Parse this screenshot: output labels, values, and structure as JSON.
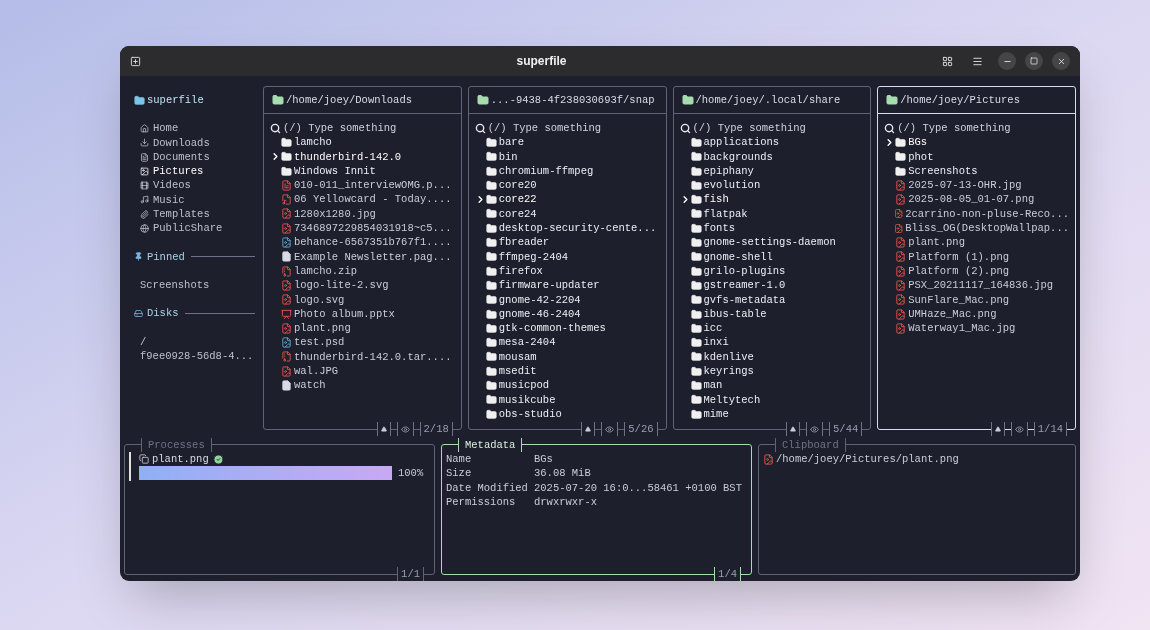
{
  "window": {
    "title": "superfile"
  },
  "sidebar": {
    "title": "superfile",
    "items": [
      {
        "label": "Home",
        "kind": "home",
        "selected": false
      },
      {
        "label": "Downloads",
        "kind": "downloads",
        "selected": false
      },
      {
        "label": "Documents",
        "kind": "documents",
        "selected": false
      },
      {
        "label": "Pictures",
        "kind": "pictures",
        "selected": true
      },
      {
        "label": "Videos",
        "kind": "videos",
        "selected": false
      },
      {
        "label": "Music",
        "kind": "music",
        "selected": false
      },
      {
        "label": "Templates",
        "kind": "templates",
        "selected": false
      },
      {
        "label": "PublicShare",
        "kind": "public",
        "selected": false
      }
    ],
    "pinned": {
      "title": "Pinned",
      "items": [
        "Screenshots"
      ]
    },
    "disks": {
      "title": "Disks",
      "items": [
        "/",
        "f9ee0928-56d8-4..."
      ]
    }
  },
  "panels": [
    {
      "path": "/home/joey/Downloads",
      "focused": false,
      "search": {
        "placeholder": "(/) Type something"
      },
      "count": "2/18",
      "entries": [
        {
          "name": "lamcho",
          "kind": "folder",
          "selected": false
        },
        {
          "name": "thunderbird-142.0",
          "kind": "folder",
          "selected": true
        },
        {
          "name": "Windows Innit",
          "kind": "folder",
          "selected": false
        },
        {
          "name": "010-011_interviewOMG.p...",
          "kind": "pdf",
          "selected": false
        },
        {
          "name": "06 Yellowcard - Today....",
          "kind": "audio",
          "selected": false
        },
        {
          "name": "1280x1280.jpg",
          "kind": "image",
          "selected": false
        },
        {
          "name": "7346897229854031918~c5...",
          "kind": "image",
          "selected": false
        },
        {
          "name": "behance-6567351b767f1....",
          "kind": "psd",
          "selected": false
        },
        {
          "name": "Example Newsletter.pag...",
          "kind": "document",
          "selected": false
        },
        {
          "name": "lamcho.zip",
          "kind": "archive",
          "selected": false
        },
        {
          "name": "logo-lite-2.svg",
          "kind": "image",
          "selected": false
        },
        {
          "name": "logo.svg",
          "kind": "image",
          "selected": false
        },
        {
          "name": "Photo album.pptx",
          "kind": "slides",
          "selected": false
        },
        {
          "name": "plant.png",
          "kind": "image",
          "selected": false
        },
        {
          "name": "test.psd",
          "kind": "psd",
          "selected": false
        },
        {
          "name": "thunderbird-142.0.tar....",
          "kind": "archive",
          "selected": false
        },
        {
          "name": "wal.JPG",
          "kind": "image",
          "selected": false
        },
        {
          "name": "watch",
          "kind": "document",
          "selected": false
        }
      ]
    },
    {
      "path": "...-9438-4f238030693f/snap",
      "focused": false,
      "search": {
        "placeholder": "(/) Type something"
      },
      "count": "5/26",
      "entries": [
        {
          "name": "bare",
          "kind": "folder",
          "selected": false
        },
        {
          "name": "bin",
          "kind": "folder",
          "selected": false
        },
        {
          "name": "chromium-ffmpeg",
          "kind": "folder",
          "selected": false
        },
        {
          "name": "core20",
          "kind": "folder",
          "selected": false
        },
        {
          "name": "core22",
          "kind": "folder",
          "selected": true
        },
        {
          "name": "core24",
          "kind": "folder",
          "selected": false
        },
        {
          "name": "desktop-security-cente...",
          "kind": "folder",
          "selected": false
        },
        {
          "name": "fbreader",
          "kind": "folder",
          "selected": false
        },
        {
          "name": "ffmpeg-2404",
          "kind": "folder",
          "selected": false
        },
        {
          "name": "firefox",
          "kind": "folder",
          "selected": false
        },
        {
          "name": "firmware-updater",
          "kind": "folder",
          "selected": false
        },
        {
          "name": "gnome-42-2204",
          "kind": "folder",
          "selected": false
        },
        {
          "name": "gnome-46-2404",
          "kind": "folder",
          "selected": false
        },
        {
          "name": "gtk-common-themes",
          "kind": "folder",
          "selected": false
        },
        {
          "name": "mesa-2404",
          "kind": "folder",
          "selected": false
        },
        {
          "name": "mousam",
          "kind": "folder",
          "selected": false
        },
        {
          "name": "msedit",
          "kind": "folder",
          "selected": false
        },
        {
          "name": "musicpod",
          "kind": "folder",
          "selected": false
        },
        {
          "name": "musikcube",
          "kind": "folder",
          "selected": false
        },
        {
          "name": "obs-studio",
          "kind": "folder",
          "selected": false
        }
      ]
    },
    {
      "path": "/home/joey/.local/share",
      "focused": false,
      "search": {
        "placeholder": "(/) Type something"
      },
      "count": "5/44",
      "entries": [
        {
          "name": "applications",
          "kind": "folder",
          "selected": false
        },
        {
          "name": "backgrounds",
          "kind": "folder",
          "selected": false
        },
        {
          "name": "epiphany",
          "kind": "folder",
          "selected": false
        },
        {
          "name": "evolution",
          "kind": "folder",
          "selected": false
        },
        {
          "name": "fish",
          "kind": "folder",
          "selected": true
        },
        {
          "name": "flatpak",
          "kind": "folder",
          "selected": false
        },
        {
          "name": "fonts",
          "kind": "folder",
          "selected": false
        },
        {
          "name": "gnome-settings-daemon",
          "kind": "folder",
          "selected": false
        },
        {
          "name": "gnome-shell",
          "kind": "folder",
          "selected": false
        },
        {
          "name": "grilo-plugins",
          "kind": "folder",
          "selected": false
        },
        {
          "name": "gstreamer-1.0",
          "kind": "folder",
          "selected": false
        },
        {
          "name": "gvfs-metadata",
          "kind": "folder",
          "selected": false
        },
        {
          "name": "ibus-table",
          "kind": "folder",
          "selected": false
        },
        {
          "name": "icc",
          "kind": "folder",
          "selected": false
        },
        {
          "name": "inxi",
          "kind": "folder",
          "selected": false
        },
        {
          "name": "kdenlive",
          "kind": "folder",
          "selected": false
        },
        {
          "name": "keyrings",
          "kind": "folder",
          "selected": false
        },
        {
          "name": "man",
          "kind": "folder",
          "selected": false
        },
        {
          "name": "Meltytech",
          "kind": "folder",
          "selected": false
        },
        {
          "name": "mime",
          "kind": "folder",
          "selected": false
        }
      ]
    },
    {
      "path": "/home/joey/Pictures",
      "focused": true,
      "search": {
        "placeholder": "(/) Type something"
      },
      "count": "1/14",
      "entries": [
        {
          "name": "BGs",
          "kind": "folder",
          "selected": true
        },
        {
          "name": "phot",
          "kind": "folder",
          "selected": false
        },
        {
          "name": "Screenshots",
          "kind": "folder",
          "selected": false
        },
        {
          "name": "2025-07-13-OHR.jpg",
          "kind": "image",
          "selected": false
        },
        {
          "name": "2025-08-05_01-07.png",
          "kind": "image",
          "selected": false
        },
        {
          "name": "2carrino-non-pluse-Reco...",
          "kind": "image",
          "selected": false
        },
        {
          "name": "Bliss_OG(DesktopWallpap...",
          "kind": "image",
          "selected": false
        },
        {
          "name": "plant.png",
          "kind": "image",
          "selected": false
        },
        {
          "name": "Platform (1).png",
          "kind": "image",
          "selected": false
        },
        {
          "name": "Platform (2).png",
          "kind": "image",
          "selected": false
        },
        {
          "name": "PSX_20211117_164836.jpg",
          "kind": "image",
          "selected": false
        },
        {
          "name": "SunFlare_Mac.png",
          "kind": "image",
          "selected": false
        },
        {
          "name": "UMHaze_Mac.png",
          "kind": "image",
          "selected": false
        },
        {
          "name": "Waterway1_Mac.jpg",
          "kind": "image",
          "selected": false
        }
      ]
    }
  ],
  "processes": {
    "title": "Processes",
    "focused": false,
    "count": "1/1",
    "items": [
      {
        "name": "plant.png",
        "done": true,
        "level": 1,
        "percent": "100%"
      }
    ]
  },
  "metadata": {
    "title": "Metadata",
    "focused": true,
    "count": "1/4",
    "rows": [
      {
        "key": "Name",
        "value": "BGs"
      },
      {
        "key": "Size",
        "value": "36.08 MiB"
      },
      {
        "key": "Date Modified",
        "value": "2025-07-20 16:0...58461 +0100 BST"
      },
      {
        "key": "Permissions",
        "value": "drwxrwxr-x"
      }
    ]
  },
  "clipboard": {
    "title": "Clipboard",
    "focused": false,
    "items": [
      {
        "path": "/home/joey/Pictures/plant.png",
        "kind": "image"
      }
    ]
  }
}
